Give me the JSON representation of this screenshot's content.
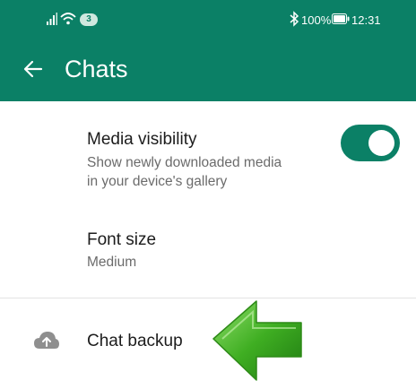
{
  "status_bar": {
    "notification_count": "3",
    "battery_percent": "100%",
    "time": "12:31",
    "icons": [
      "signal-icon",
      "wifi-icon",
      "bluetooth-icon",
      "battery-icon"
    ]
  },
  "header": {
    "title": "Chats",
    "back_icon": "arrow-left-icon"
  },
  "settings": {
    "media_visibility": {
      "title": "Media visibility",
      "description_line1": "Show newly downloaded media",
      "description_line2": "in your device's gallery",
      "toggle_on": true
    },
    "font_size": {
      "title": "Font size",
      "value": "Medium"
    },
    "chat_backup": {
      "title": "Chat backup",
      "icon": "cloud-upload-icon"
    }
  },
  "overlay": {
    "arrow_icon": "green-arrow-left-icon"
  },
  "colors": {
    "header_bg": "#0b8066",
    "toggle_on": "#0b8066",
    "arrow": "#3aa71f"
  }
}
